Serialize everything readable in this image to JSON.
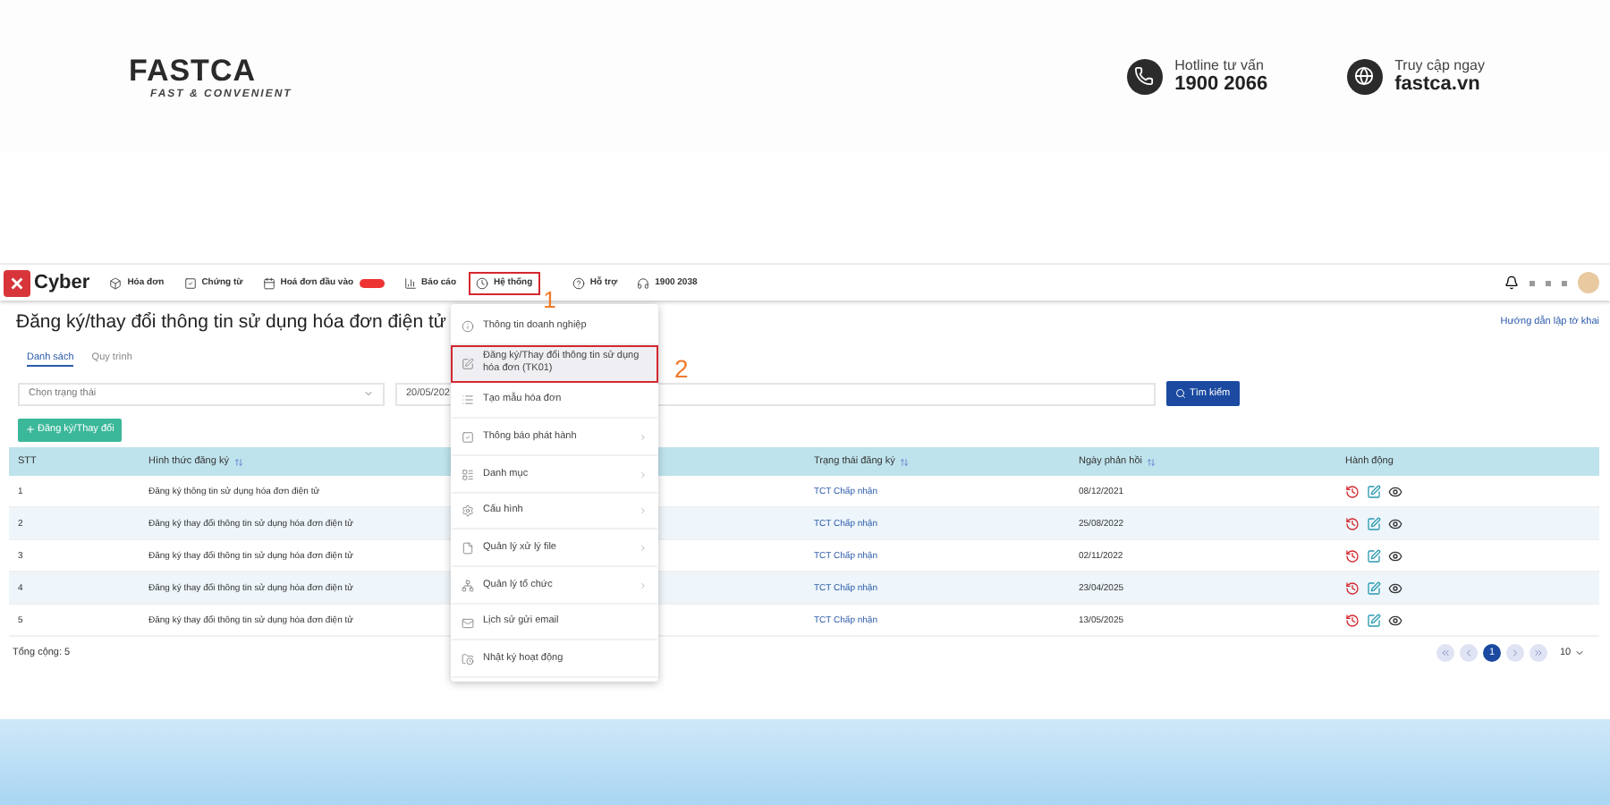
{
  "header": {
    "logo": {
      "name": "FASTCA",
      "tagline": "FAST & CONVENIENT"
    },
    "contacts": [
      {
        "kind": "phone",
        "label": "Hotline tư vấn",
        "value": "1900 2066"
      },
      {
        "kind": "globe",
        "label": "Truy cập ngay",
        "value": "fastca.vn"
      }
    ]
  },
  "app": {
    "brand": "Cyber",
    "nav": [
      {
        "kind": "box",
        "label": "Hóa đơn",
        "selected": false,
        "badge": false
      },
      {
        "kind": "check",
        "label": "Chứng từ",
        "selected": false,
        "badge": false
      },
      {
        "kind": "calendar",
        "label": "Hoá đơn đầu vào",
        "selected": false,
        "badge": true
      },
      {
        "kind": "chart",
        "label": "Báo cáo",
        "selected": false,
        "badge": false
      },
      {
        "kind": "clock",
        "label": "Hệ thống",
        "selected": true,
        "badge": false
      },
      {
        "kind": "help",
        "label": "Hỗ trợ",
        "selected": false,
        "badge": false
      },
      {
        "kind": "headset",
        "label": "1900 2038",
        "selected": false,
        "badge": false
      }
    ],
    "title": "Đăng ký/thay đổi thông tin sử dụng hóa đơn điện tử",
    "help_link": "Hướng dẫn lập tờ khai",
    "tabs": [
      {
        "label": "Danh sách",
        "selected": true
      },
      {
        "label": "Quy trình",
        "selected": false
      }
    ],
    "status_filter": {
      "placeholder": "Chọn trạng thái"
    },
    "date_field": {
      "value": "20/05/202"
    },
    "search_button": "Tìm kiếm",
    "add_button": "Đăng ký/Thay đổi",
    "table": {
      "columns": [
        {
          "label": "STT",
          "sortable": false
        },
        {
          "label": "Hình thức đăng ký",
          "sortable": true
        },
        {
          "label": "Trạng thái đăng ký",
          "sortable": true
        },
        {
          "label": "Ngày phản hồi",
          "sortable": true
        },
        {
          "label": "Hành động",
          "sortable": false
        }
      ],
      "rows": [
        {
          "stt": "1",
          "form": "Đăng ký thông tin sử dụng hóa đơn điện tử",
          "status": "TCT Chấp nhận",
          "date": "08/12/2021"
        },
        {
          "stt": "2",
          "form": "Đăng ký thay đổi thông tin sử dụng hóa đơn điện tử",
          "status": "TCT Chấp nhận",
          "date": "25/08/2022"
        },
        {
          "stt": "3",
          "form": "Đăng ký thay đổi thông tin sử dụng hóa đơn điện tử",
          "status": "TCT Chấp nhận",
          "date": "02/11/2022"
        },
        {
          "stt": "4",
          "form": "Đăng ký thay đổi thông tin sử dụng hóa đơn điện tử",
          "status": "TCT Chấp nhận",
          "date": "23/04/2025"
        },
        {
          "stt": "5",
          "form": "Đăng ký thay đổi thông tin sử dụng hóa đơn điện tử",
          "status": "TCT Chấp nhận",
          "date": "13/05/2025"
        }
      ]
    },
    "total": "Tổng cộng: 5",
    "pagination": {
      "pages": [
        {
          "label": "1",
          "selected": true
        }
      ],
      "page_size": "10"
    },
    "menu": [
      {
        "kind": "info",
        "label": "Thông tin doanh nghiệp",
        "selected": false,
        "submenu": false
      },
      {
        "kind": "edit",
        "label": "Đăng ký/Thay đổi thông tin sử dụng hóa đơn (TK01)",
        "selected": true,
        "submenu": false
      },
      {
        "kind": "list",
        "label": "Tạo mẫu hóa đơn",
        "selected": false,
        "submenu": false
      },
      {
        "kind": "check",
        "label": "Thông báo phát hành",
        "selected": false,
        "submenu": true
      },
      {
        "kind": "layout",
        "label": "Danh mục",
        "selected": false,
        "submenu": true
      },
      {
        "kind": "gear",
        "label": "Cấu hình",
        "selected": false,
        "submenu": true
      },
      {
        "kind": "file",
        "label": "Quản lý xử lý file",
        "selected": false,
        "submenu": true
      },
      {
        "kind": "network",
        "label": "Quản lý tổ chức",
        "selected": false,
        "submenu": true
      },
      {
        "kind": "mail",
        "label": "Lịch sử gửi email",
        "selected": false,
        "submenu": false
      },
      {
        "kind": "folder",
        "label": "Nhật ký hoạt động",
        "selected": false,
        "submenu": false
      }
    ],
    "step_labels": [
      "1",
      "2"
    ]
  }
}
